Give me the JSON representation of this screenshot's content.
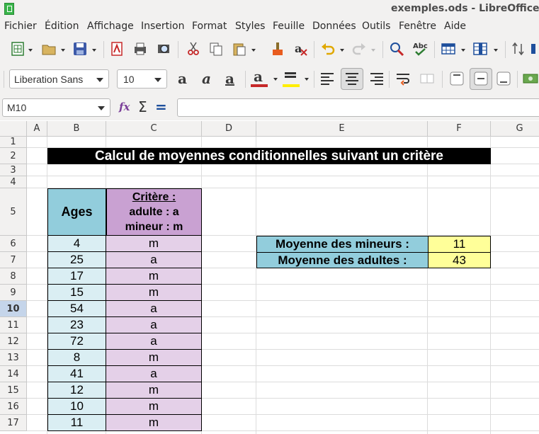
{
  "window": {
    "title": "exemples.ods - LibreOffice Calc"
  },
  "menu": [
    "Fichier",
    "Édition",
    "Affichage",
    "Insertion",
    "Format",
    "Styles",
    "Feuille",
    "Données",
    "Outils",
    "Fenêtre",
    "Aide"
  ],
  "toolbar": {
    "font_name": "Liberation Sans",
    "font_size": "10",
    "bold_glyph": "a",
    "italic_glyph": "a",
    "underline_glyph": "a",
    "font_color_glyph": "a"
  },
  "formula_bar": {
    "cell_ref": "M10",
    "function_wizard": "fx",
    "sum_symbol": "Σ",
    "equals_symbol": "=",
    "content": ""
  },
  "grid": {
    "columns": [
      "A",
      "B",
      "C",
      "D",
      "E",
      "F",
      "G"
    ],
    "rows": [
      "1",
      "2",
      "3",
      "4",
      "5",
      "6",
      "7",
      "8",
      "9",
      "10",
      "11",
      "12",
      "13",
      "14",
      "15",
      "16",
      "17"
    ],
    "active_row": "10"
  },
  "sheet": {
    "title": "Calcul de moyennes conditionnelles suivant un critère",
    "ages_header": "Ages",
    "criteria_header": {
      "line1": "Critère :",
      "line2": "adulte : a",
      "line3": "mineur : m"
    },
    "ages": [
      "4",
      "25",
      "17",
      "15",
      "54",
      "23",
      "72",
      "8",
      "41",
      "12",
      "10",
      "11"
    ],
    "criteria": [
      "m",
      "a",
      "m",
      "m",
      "a",
      "a",
      "a",
      "m",
      "a",
      "m",
      "m",
      "m"
    ],
    "summary": [
      {
        "label": "Moyenne des mineurs :",
        "value": "11"
      },
      {
        "label": "Moyenne des adultes :",
        "value": "43"
      }
    ]
  },
  "colors": {
    "banner_bg": "#000000",
    "ages_bg": "#92cddc",
    "ages_cell_bg": "#daeef3",
    "criteria_header_bg": "#c9a1d2",
    "criteria_cell_bg": "#e4d0e8",
    "value_bg": "#ffff99"
  }
}
